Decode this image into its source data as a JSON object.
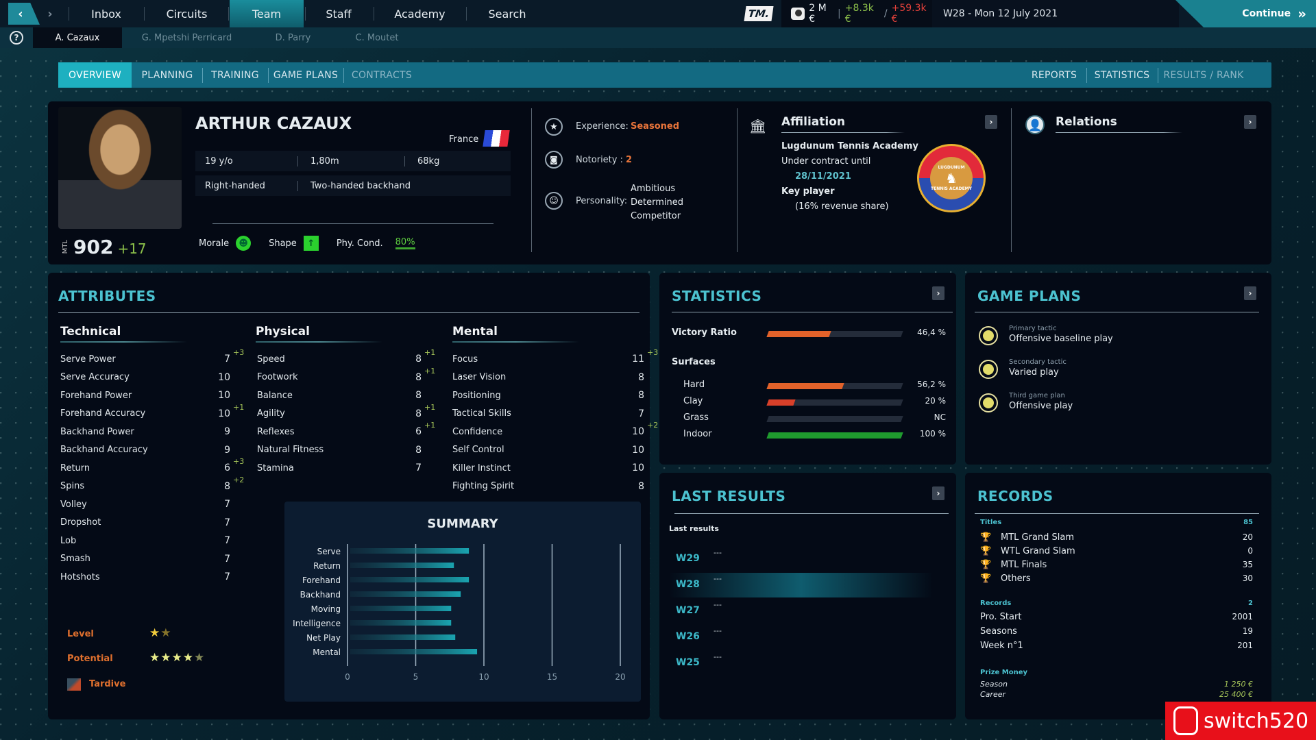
{
  "topbar": {
    "nav": [
      "Inbox",
      "Circuits",
      "Team",
      "Staff",
      "Academy",
      "Search"
    ],
    "active_nav": "Team",
    "brand": "TM.",
    "money": {
      "balance": "2 M €",
      "income": "+8.3k €",
      "expense": "+59.3k €"
    },
    "date": "W28 - Mon 12 July 2021",
    "continue_label": "Continue"
  },
  "player_tabs": [
    "A. Cazaux",
    "G. Mpetshi Perricard",
    "D. Parry",
    "C. Moutet"
  ],
  "section_tabs": {
    "left": [
      "OVERVIEW",
      "PLANNING",
      "TRAINING",
      "GAME PLANS",
      "CONTRACTS"
    ],
    "right": [
      "REPORTS",
      "STATISTICS",
      "RESULTS / RANK"
    ]
  },
  "player": {
    "name": "ARTHUR CAZAUX",
    "country": "France",
    "age": "19 y/o",
    "height": "1,80m",
    "weight": "68kg",
    "hand": "Right-handed",
    "backhand": "Two-handed backhand",
    "ranking_label": "MTL",
    "ranking_points": "902",
    "ranking_delta": "+17",
    "morale_label": "Morale",
    "shape_label": "Shape",
    "phy_label": "Phy. Cond.",
    "phy_value": "80%",
    "experience_label": "Experience:",
    "experience": "Seasoned",
    "notoriety_label": "Notoriety :",
    "notoriety": "2",
    "personality_label": "Personality:",
    "personality": [
      "Ambitious",
      "Determined",
      "Competitor"
    ]
  },
  "affiliation": {
    "title": "Affiliation",
    "academy": "Lugdunum Tennis Academy",
    "contract_label": "Under contract until",
    "contract_date": "28/11/2021",
    "role": "Key player",
    "share": "(16% revenue share)",
    "logo_top": "LUGDUNUM",
    "logo_bottom": "TENNIS ACADEMY"
  },
  "relations": {
    "title": "Relations"
  },
  "attributes": {
    "title": "ATTRIBUTES",
    "technical": {
      "title": "Technical",
      "items": [
        {
          "name": "Serve Power",
          "value": "7",
          "bonus": "+3"
        },
        {
          "name": "Serve Accuracy",
          "value": "10",
          "bonus": ""
        },
        {
          "name": "Forehand Power",
          "value": "10",
          "bonus": ""
        },
        {
          "name": "Forehand Accuracy",
          "value": "10",
          "bonus": "+1"
        },
        {
          "name": "Backhand Power",
          "value": "9",
          "bonus": ""
        },
        {
          "name": "Backhand Accuracy",
          "value": "9",
          "bonus": ""
        },
        {
          "name": "Return",
          "value": "6",
          "bonus": "+3"
        },
        {
          "name": "Spins",
          "value": "8",
          "bonus": "+2"
        },
        {
          "name": "Volley",
          "value": "7",
          "bonus": ""
        },
        {
          "name": "Dropshot",
          "value": "7",
          "bonus": ""
        },
        {
          "name": "Lob",
          "value": "7",
          "bonus": ""
        },
        {
          "name": "Smash",
          "value": "7",
          "bonus": ""
        },
        {
          "name": "Hotshots",
          "value": "7",
          "bonus": ""
        }
      ]
    },
    "physical": {
      "title": "Physical",
      "items": [
        {
          "name": "Speed",
          "value": "8",
          "bonus": "+1"
        },
        {
          "name": "Footwork",
          "value": "8",
          "bonus": "+1"
        },
        {
          "name": "Balance",
          "value": "8",
          "bonus": ""
        },
        {
          "name": "Agility",
          "value": "8",
          "bonus": "+1"
        },
        {
          "name": "Reflexes",
          "value": "6",
          "bonus": "+1"
        },
        {
          "name": "Natural Fitness",
          "value": "8",
          "bonus": ""
        },
        {
          "name": "Stamina",
          "value": "7",
          "bonus": ""
        }
      ]
    },
    "mental": {
      "title": "Mental",
      "items": [
        {
          "name": "Focus",
          "value": "11",
          "bonus": "+3"
        },
        {
          "name": "Laser Vision",
          "value": "8",
          "bonus": ""
        },
        {
          "name": "Positioning",
          "value": "8",
          "bonus": ""
        },
        {
          "name": "Tactical Skills",
          "value": "7",
          "bonus": ""
        },
        {
          "name": "Confidence",
          "value": "10",
          "bonus": "+2"
        },
        {
          "name": "Self Control",
          "value": "10",
          "bonus": ""
        },
        {
          "name": "Killer Instinct",
          "value": "10",
          "bonus": ""
        },
        {
          "name": "Fighting Spirit",
          "value": "8",
          "bonus": ""
        }
      ]
    },
    "level_label": "Level",
    "level_stars": 1.5,
    "potential_label": "Potential",
    "potential_stars": 4.5,
    "development": "Tardive"
  },
  "chart_data": {
    "type": "bar",
    "orientation": "horizontal",
    "title": "SUMMARY",
    "categories": [
      "Serve",
      "Return",
      "Forehand",
      "Backhand",
      "Moving",
      "Intelligence",
      "Net Play",
      "Mental"
    ],
    "values": [
      8.9,
      7.8,
      8.9,
      8.3,
      7.6,
      7.6,
      7.9,
      9.5
    ],
    "xlim": [
      0,
      20
    ],
    "xticks": [
      0,
      5,
      10,
      15,
      20
    ],
    "grid": true,
    "xlabel": "",
    "ylabel": ""
  },
  "statistics": {
    "title": "STATISTICS",
    "victory_label": "Victory Ratio",
    "victory_pct": 46.4,
    "victory_text": "46,4 %",
    "surfaces_label": "Surfaces",
    "surfaces": [
      {
        "name": "Hard",
        "pct": 56.2,
        "text": "56,2 %",
        "color": "#e2622a"
      },
      {
        "name": "Clay",
        "pct": 20,
        "text": "20 %",
        "color": "#d8402a"
      },
      {
        "name": "Grass",
        "pct": 0,
        "text": "NC",
        "color": "#242c3a"
      },
      {
        "name": "Indoor",
        "pct": 100,
        "text": "100 %",
        "color": "#1f9b2e"
      }
    ]
  },
  "game_plans": {
    "title": "GAME PLANS",
    "plans": [
      {
        "label": "Primary tactic",
        "value": "Offensive baseline play"
      },
      {
        "label": "Secondary tactic",
        "value": "Varied play"
      },
      {
        "label": "Third game plan",
        "value": "Offensive play"
      }
    ]
  },
  "last_results": {
    "title": "LAST RESULTS",
    "subtitle": "Last results",
    "rows": [
      {
        "week": "W29",
        "result": "---"
      },
      {
        "week": "W28",
        "result": "---",
        "current": true
      },
      {
        "week": "W27",
        "result": "---"
      },
      {
        "week": "W26",
        "result": "---"
      },
      {
        "week": "W25",
        "result": "---"
      }
    ]
  },
  "records": {
    "title": "RECORDS",
    "titles_label": "Titles",
    "titles_total": "85",
    "titles": [
      {
        "name": "MTL Grand Slam",
        "value": "20"
      },
      {
        "name": "WTL Grand Slam",
        "value": "0"
      },
      {
        "name": "MTL Finals",
        "value": "35"
      },
      {
        "name": "Others",
        "value": "30"
      }
    ],
    "records_label": "Records",
    "records_total": "2",
    "records": [
      {
        "name": "Pro. Start",
        "value": "2001"
      },
      {
        "name": "Seasons",
        "value": "19"
      },
      {
        "name": "Week n°1",
        "value": "201"
      }
    ],
    "prize_label": "Prize Money",
    "prize": [
      {
        "name": "Season",
        "value": "1 250 €"
      },
      {
        "name": "Career",
        "value": "25 400 €"
      }
    ]
  },
  "watermark": "switch520",
  "colors": {
    "accent": "#4cc2d0",
    "orange": "#e2622a",
    "green": "#1f9b2e",
    "bonus": "#a8c85a"
  }
}
